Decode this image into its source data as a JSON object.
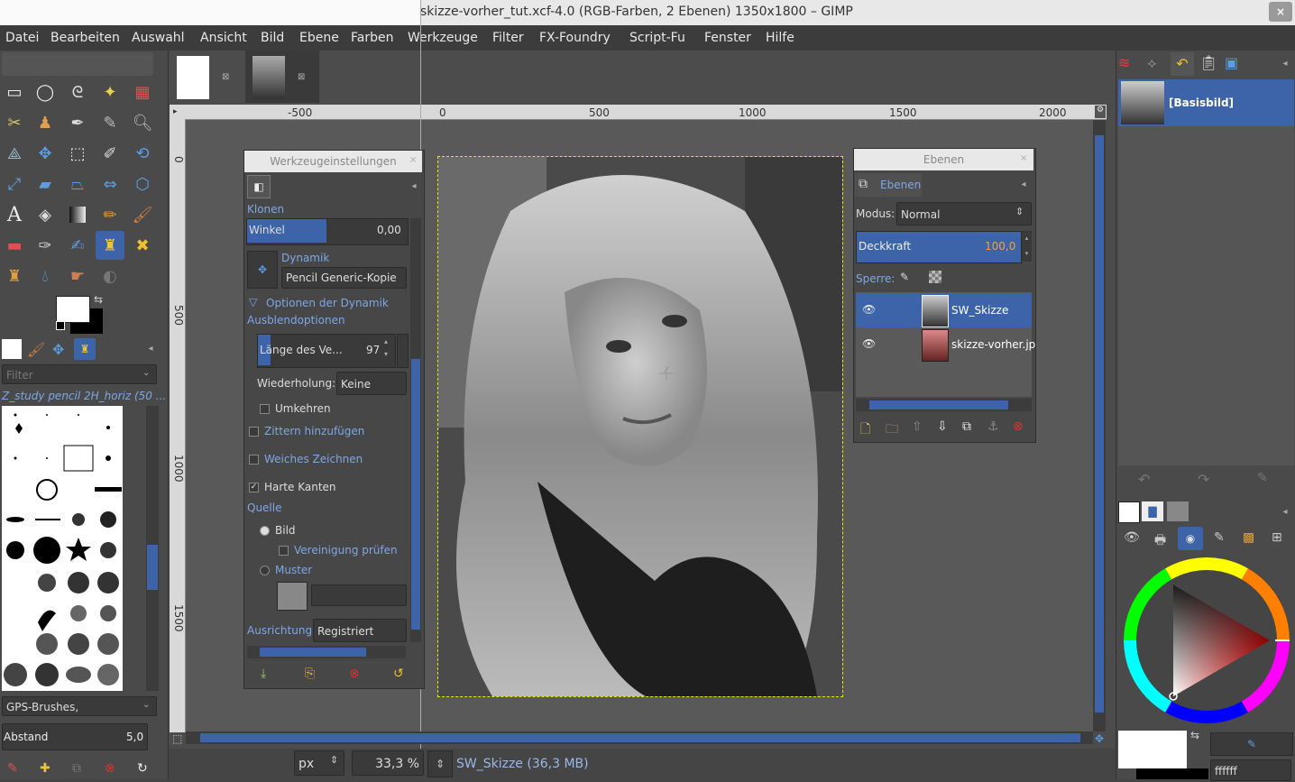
{
  "window": {
    "title": "skizze-vorher_tut.xcf-4.0 (RGB-Farben, 2 Ebenen) 1350x1800 – GIMP",
    "close_icon": "×"
  },
  "menubar": [
    "Datei",
    "Bearbeiten",
    "Auswahl",
    "Ansicht",
    "Bild",
    "Ebene",
    "Farben",
    "Werkzeuge",
    "Filter",
    "FX-Foundry",
    "Script-Fu",
    "Fenster",
    "Hilfe"
  ],
  "rulers": {
    "horizontal": [
      "-500",
      "0",
      "500",
      "1000",
      "1500",
      "2000"
    ],
    "vertical": [
      "0",
      "500",
      "1000",
      "1500"
    ]
  },
  "toolbox": {
    "brush_filter_placeholder": "Filter",
    "brush_name": "Z_study pencil 2H_horiz (50 ...",
    "brush_set": "GPS-Brushes,",
    "spacing_label": "Abstand",
    "spacing_value": "5,0"
  },
  "tool_options": {
    "title": "Werkzeugeinstellungen",
    "tool_name": "Klonen",
    "angle_label": "Winkel",
    "angle_value": "0,00",
    "dynamics_label": "Dynamik",
    "dynamics_value": "Pencil Generic-Kopie",
    "dynamics_options": "Optionen der Dynamik",
    "fade_options": "Ausblendoptionen",
    "fade_length_label": "Länge des Ve...",
    "fade_length_value": "97",
    "repeat_label": "Wiederholung:",
    "repeat_value": "Keine",
    "reverse_label": "Umkehren",
    "jitter_label": "Zittern hinzufügen",
    "smooth_label": "Weiches Zeichnen",
    "hard_edges_label": "Harte Kanten",
    "source_label": "Quelle",
    "source_image": "Bild",
    "sample_merged": "Vereinigung prüfen",
    "source_pattern": "Muster",
    "alignment_label": "Ausrichtung:",
    "alignment_value": "Registriert"
  },
  "layers_dialog": {
    "title": "Ebenen",
    "tab_label": "Ebenen",
    "mode_label": "Modus:",
    "mode_value": "Normal",
    "opacity_label": "Deckkraft",
    "opacity_value": "100,0",
    "lock_label": "Sperre:",
    "layers": [
      {
        "name": "SW_Skizze",
        "selected": true
      },
      {
        "name": "skizze-vorher.jp",
        "selected": false
      }
    ]
  },
  "right_dock": {
    "image_name": "[Basisbild]",
    "hex_value": "ffffff"
  },
  "status": {
    "unit": "px",
    "zoom": "33,3 %",
    "layer_info": "SW_Skizze (36,3 MB)"
  },
  "colors": {
    "accent_blue": "#3d64a8",
    "selection_blue": "#4a70b8"
  }
}
